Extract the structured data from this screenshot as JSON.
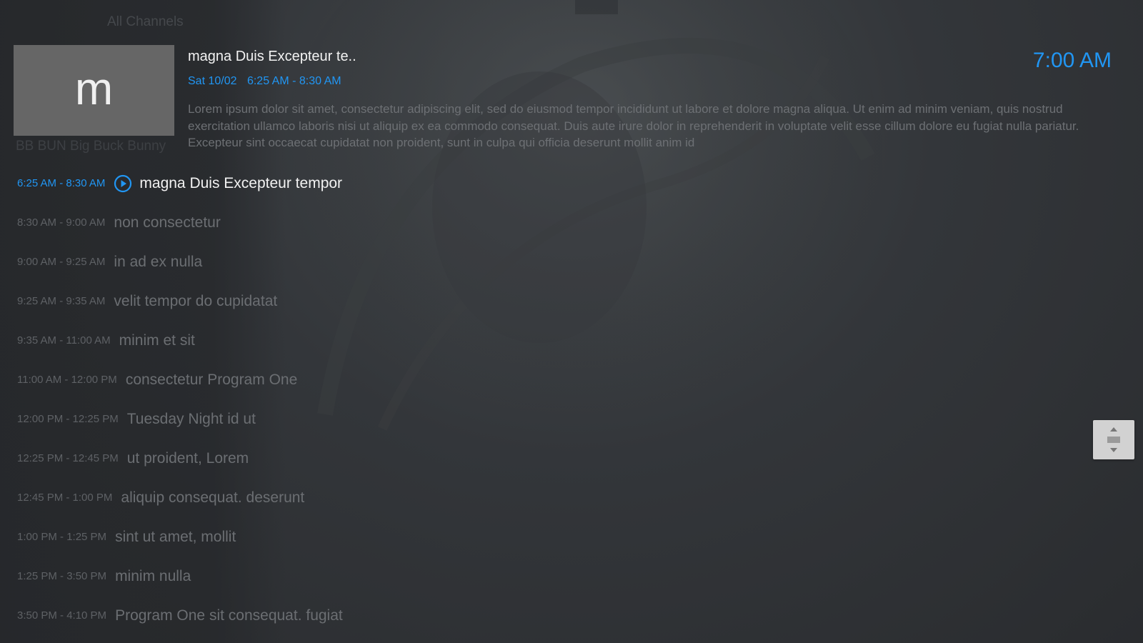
{
  "background": {
    "header_ghost": "All Channels",
    "channel_ghost": "BB BUN Big Buck Bunny"
  },
  "program": {
    "thumbnail_letter": "m",
    "title": "magna Duis Excepteur te..",
    "date": "Sat 10/02",
    "time_range": "6:25 AM - 8:30 AM",
    "description": "Lorem ipsum dolor sit amet, consectetur adipiscing elit, sed do eiusmod tempor incididunt ut labore et dolore magna aliqua. Ut enim ad minim veniam, quis nostrud exercitation ullamco laboris nisi ut aliquip ex ea commodo consequat. Duis aute irure dolor in reprehenderit in voluptate velit esse cillum dolore eu fugiat nulla pariatur. Excepteur sint occaecat cupidatat non proident, sunt in culpa qui officia deserunt mollit anim id"
  },
  "clock": "7:00 AM",
  "schedule": [
    {
      "time": "6:25 AM - 8:30 AM",
      "title": "magna Duis Excepteur tempor",
      "active": true
    },
    {
      "time": "8:30 AM - 9:00 AM",
      "title": "non consectetur"
    },
    {
      "time": "9:00 AM - 9:25 AM",
      "title": "in ad ex nulla"
    },
    {
      "time": "9:25 AM - 9:35 AM",
      "title": "velit tempor do cupidatat"
    },
    {
      "time": "9:35 AM - 11:00 AM",
      "title": "minim et sit"
    },
    {
      "time": "11:00 AM - 12:00 PM",
      "title": "consectetur Program One"
    },
    {
      "time": "12:00 PM - 12:25 PM",
      "title": "Tuesday Night id ut"
    },
    {
      "time": "12:25 PM - 12:45 PM",
      "title": "ut proident, Lorem"
    },
    {
      "time": "12:45 PM - 1:00 PM",
      "title": "aliquip consequat. deserunt"
    },
    {
      "time": "1:00 PM - 1:25 PM",
      "title": "sint ut amet, mollit"
    },
    {
      "time": "1:25 PM - 3:50 PM",
      "title": "minim nulla"
    },
    {
      "time": "3:50 PM - 4:10 PM",
      "title": "Program One sit consequat. fugiat"
    }
  ],
  "colors": {
    "accent": "#2196f3",
    "active_text": "#f2f2f2",
    "inactive_text": "#6b6e72"
  },
  "icons": {
    "now_playing": "play-circle-icon",
    "scroll": "scroll-handle-icon"
  }
}
